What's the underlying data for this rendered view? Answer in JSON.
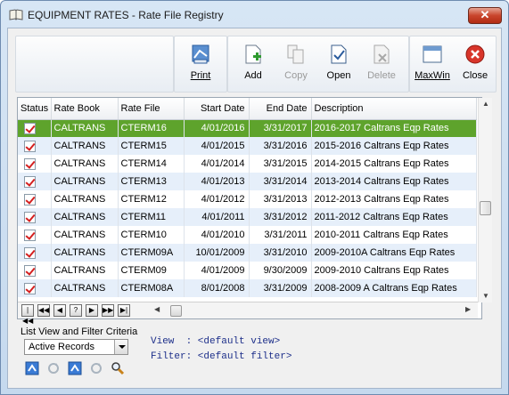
{
  "window": {
    "title": "EQUIPMENT RATES - Rate File Registry",
    "close_glyph": "✕"
  },
  "toolbar": {
    "print": "Print",
    "add": "Add",
    "copy": "Copy",
    "open": "Open",
    "delete": "Delete",
    "maxwin": "MaxWin",
    "close": "Close"
  },
  "grid": {
    "headers": {
      "status": "Status",
      "rate_book": "Rate Book",
      "rate_file": "Rate File",
      "start_date": "Start Date",
      "end_date": "End Date",
      "description": "Description"
    },
    "rows": [
      {
        "rate_book": "CALTRANS",
        "rate_file": "CTERM16",
        "start_date": "4/01/2016",
        "end_date": "3/31/2017",
        "description": "2016-2017 Caltrans Eqp Rates"
      },
      {
        "rate_book": "CALTRANS",
        "rate_file": "CTERM15",
        "start_date": "4/01/2015",
        "end_date": "3/31/2016",
        "description": "2015-2016 Caltrans Eqp Rates"
      },
      {
        "rate_book": "CALTRANS",
        "rate_file": "CTERM14",
        "start_date": "4/01/2014",
        "end_date": "3/31/2015",
        "description": "2014-2015 Caltrans Eqp Rates"
      },
      {
        "rate_book": "CALTRANS",
        "rate_file": "CTERM13",
        "start_date": "4/01/2013",
        "end_date": "3/31/2014",
        "description": "2013-2014 Caltrans Eqp Rates"
      },
      {
        "rate_book": "CALTRANS",
        "rate_file": "CTERM12",
        "start_date": "4/01/2012",
        "end_date": "3/31/2013",
        "description": "2012-2013 Caltrans Eqp Rates"
      },
      {
        "rate_book": "CALTRANS",
        "rate_file": "CTERM11",
        "start_date": "4/01/2011",
        "end_date": "3/31/2012",
        "description": "2011-2012 Caltrans Eqp Rates"
      },
      {
        "rate_book": "CALTRANS",
        "rate_file": "CTERM10",
        "start_date": "4/01/2010",
        "end_date": "3/31/2011",
        "description": "2010-2011 Caltrans Eqp Rates"
      },
      {
        "rate_book": "CALTRANS",
        "rate_file": "CTERM09A",
        "start_date": "10/01/2009",
        "end_date": "3/31/2010",
        "description": "2009-2010A Caltrans Eqp Rates"
      },
      {
        "rate_book": "CALTRANS",
        "rate_file": "CTERM09",
        "start_date": "4/01/2009",
        "end_date": "9/30/2009",
        "description": "2009-2010 Caltrans Eqp Rates"
      },
      {
        "rate_book": "CALTRANS",
        "rate_file": "CTERM08A",
        "start_date": "8/01/2008",
        "end_date": "3/31/2009",
        "description": "2008-2009 A Caltrans Eqp Rates"
      }
    ],
    "nav": [
      "|◀◀",
      "◀◀",
      "◀",
      "?",
      "▶",
      "▶▶",
      "▶|"
    ]
  },
  "filter": {
    "label": "List View and Filter Criteria",
    "selected": "Active Records",
    "view_text": "View  : <default view>",
    "filter_text": "Filter: <default filter>"
  },
  "colors": {
    "selected_row": "#5ea32c",
    "alt_row": "#e6effa",
    "check": "#d41f1f"
  }
}
